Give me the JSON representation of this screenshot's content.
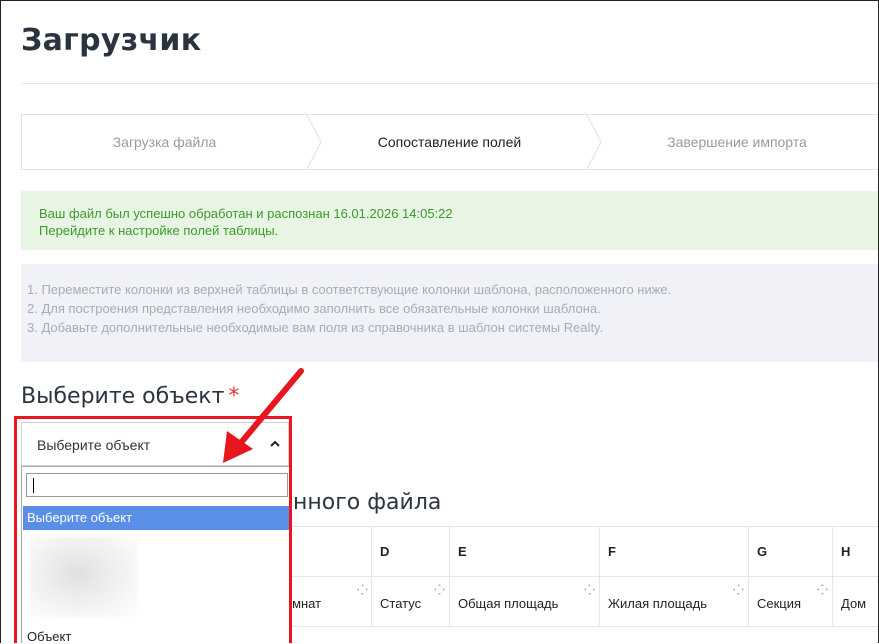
{
  "page": {
    "title": "Загрузчик"
  },
  "stepper": {
    "steps": [
      {
        "label": "Загрузка файла",
        "state": "done"
      },
      {
        "label": "Сопоставление полей",
        "state": "active"
      },
      {
        "label": "Завершение импорта",
        "state": "pending"
      }
    ]
  },
  "alert": {
    "line1": "Ваш файл был успешно обработан и распознан 16.01.2026 14:05:22",
    "line2": "Перейдите к настройке полей таблицы."
  },
  "instructions": [
    "1. Переместите колонки из верхней таблицы в соответствующие колонки шаблона, расположенного ниже.",
    "2. Для построения представления необходимо заполнить все обязательные колонки шаблона.",
    "3. Добавьте дополнительные необходимые вам поля из справочника в шаблон системы Realty."
  ],
  "object_select": {
    "heading": "Выберите объект",
    "required_mark": "*",
    "selected": "Выберите объект",
    "search_value": "",
    "options": [
      {
        "label": "Выберите объект",
        "highlighted": true
      },
      {
        "label": "",
        "blurred": true
      },
      {
        "label": "Объект",
        "highlighted": false
      }
    ]
  },
  "table": {
    "heading": "нного файла",
    "columns": [
      {
        "letter": "",
        "name": "комнат"
      },
      {
        "letter": "D",
        "name": "Статус"
      },
      {
        "letter": "E",
        "name": "Общая площадь"
      },
      {
        "letter": "F",
        "name": "Жилая площадь"
      },
      {
        "letter": "G",
        "name": "Секция"
      },
      {
        "letter": "H",
        "name": "Дом"
      }
    ]
  },
  "colors": {
    "alert_bg": "#e9f5e4",
    "alert_text": "#3c9a2a",
    "info_bg": "#f0f2f7",
    "highlight": "#5b8ee6",
    "annotation": "#e8161f"
  }
}
